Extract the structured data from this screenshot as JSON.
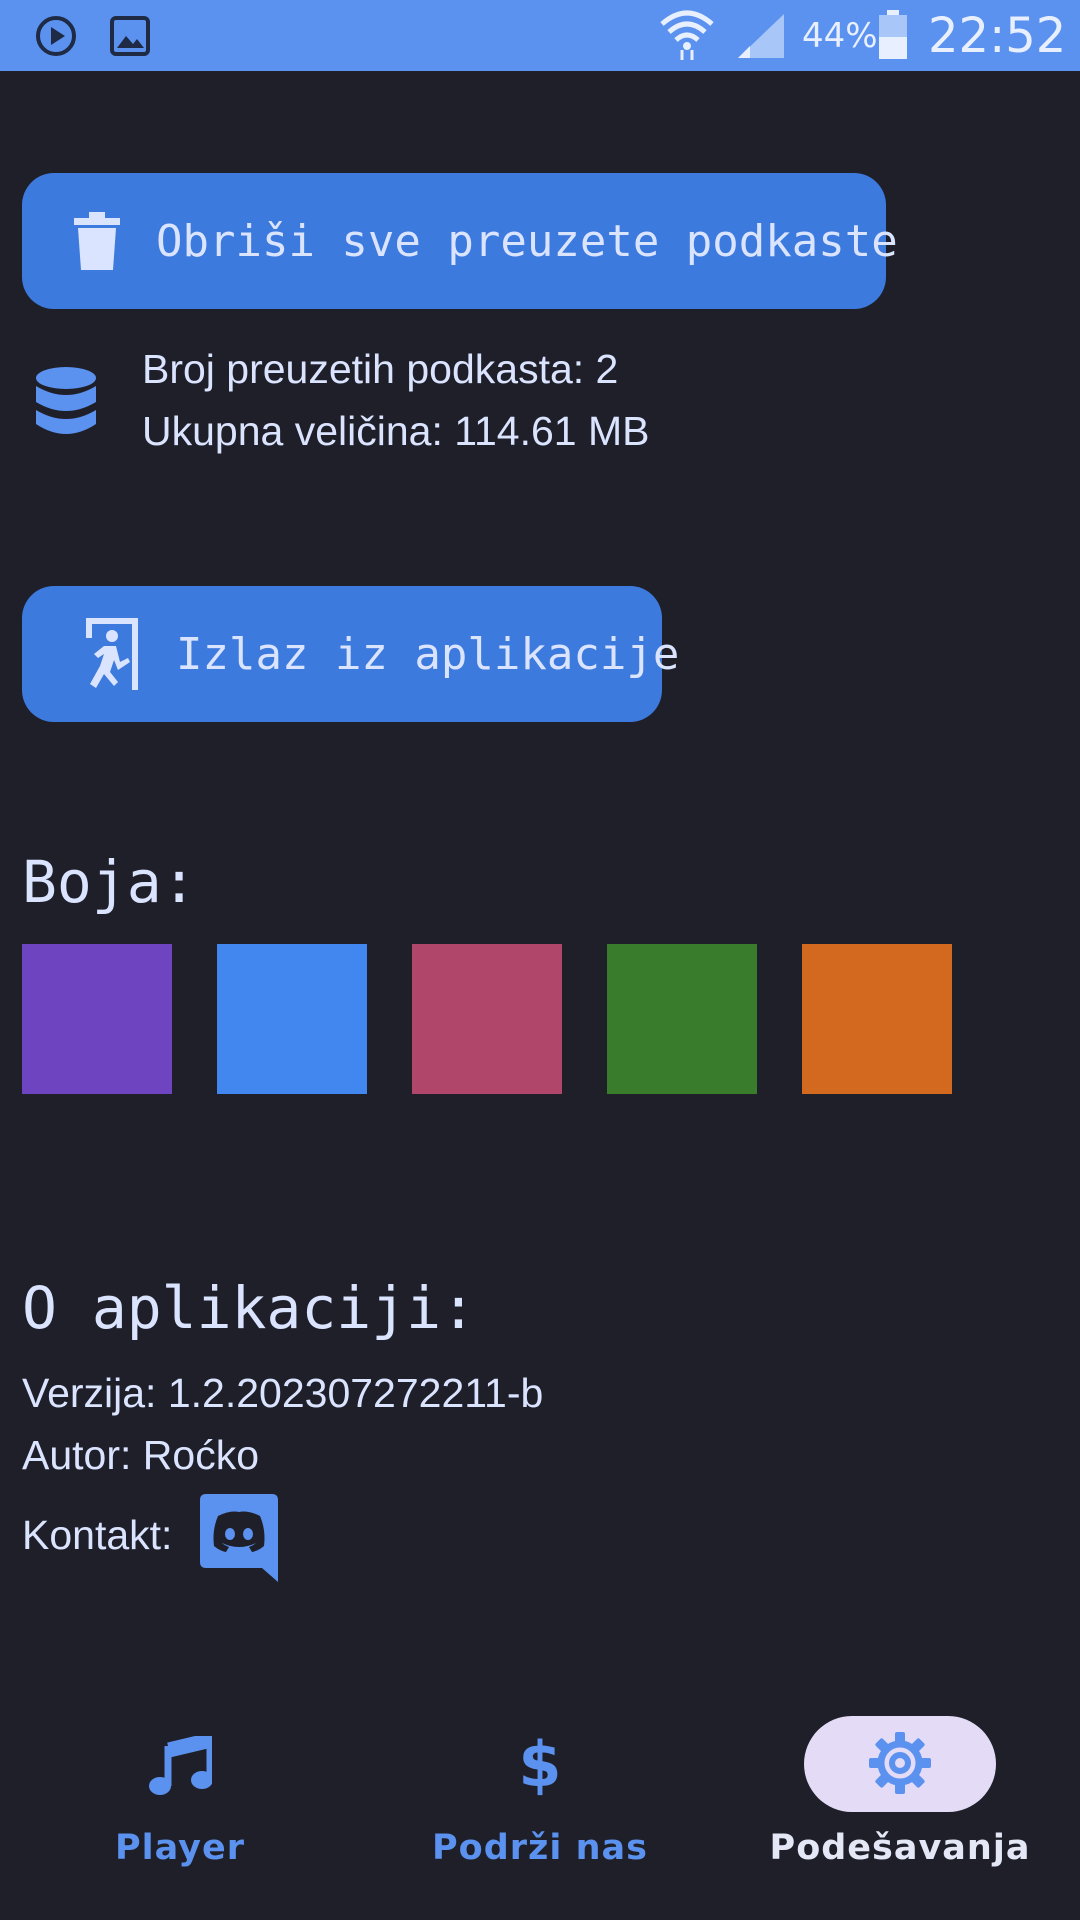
{
  "status_bar": {
    "battery_percent": "44%",
    "time": "22:52",
    "icons": [
      "play-circle-icon",
      "image-icon",
      "wifi-icon",
      "signal-icon",
      "battery-icon"
    ]
  },
  "storage": {
    "delete_button_label": "Obriši sve preuzete podkaste",
    "downloaded_count": "Broj preuzetih podkasta: 2",
    "total_size": "Ukupna veličina: 114.61 MB"
  },
  "exit_button_label": "Izlaz iz aplikacije",
  "color_section": {
    "heading": "Boja:",
    "swatches": [
      "#6e44c0",
      "#4286f0",
      "#b0476b",
      "#387c2c",
      "#d3681f"
    ]
  },
  "about": {
    "heading": "O aplikaciji:",
    "version": "Verzija: 1.2.202307272211-b",
    "author": "Autor: Roćko",
    "contact_label": "Kontakt:"
  },
  "bottom_nav": {
    "items": [
      {
        "label": "Player",
        "icon": "music-note-icon",
        "active": false
      },
      {
        "label": "Podrži nas",
        "icon": "dollar-icon",
        "active": false
      },
      {
        "label": "Podešavanja",
        "icon": "gear-icon",
        "active": true
      }
    ]
  },
  "colors": {
    "background": "#1f1f29",
    "accent": "#3d7ade",
    "status_bar": "#5b91ef",
    "text": "#dbe4ff",
    "nav_inactive": "#5b91ef",
    "nav_active_pill": "#e4dcf7"
  }
}
